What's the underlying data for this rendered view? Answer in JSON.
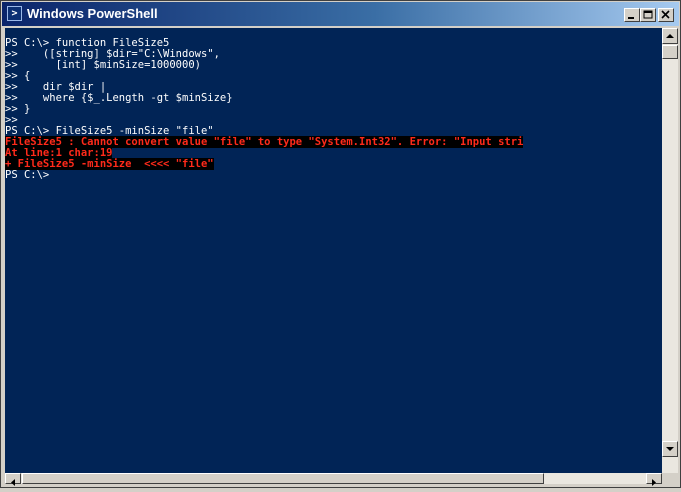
{
  "window": {
    "title": "Windows PowerShell",
    "icon": "powershell-icon",
    "accent_title_start": "#0a246a",
    "accent_title_end": "#a6caf0"
  },
  "console": {
    "background": "#012456",
    "foreground": "#ffffff",
    "error_color": "#ff2a1a",
    "lines": [
      {
        "text": "PS C:\\> function FileSize5",
        "kind": "normal"
      },
      {
        "text": ">>    ([string] $dir=\"C:\\Windows\",",
        "kind": "normal"
      },
      {
        "text": ">>      [int] $minSize=1000000)",
        "kind": "normal"
      },
      {
        "text": ">> {",
        "kind": "normal"
      },
      {
        "text": ">>    dir $dir |",
        "kind": "normal"
      },
      {
        "text": ">>    where {$_.Length -gt $minSize}",
        "kind": "normal"
      },
      {
        "text": ">> }",
        "kind": "normal"
      },
      {
        "text": ">>",
        "kind": "normal"
      },
      {
        "text": "PS C:\\> FileSize5 -minSize \"file\"",
        "kind": "normal"
      },
      {
        "text": "FileSize5 : Cannot convert value \"file\" to type \"System.Int32\". Error: \"Input stri",
        "kind": "error"
      },
      {
        "text": "At line:1 char:19",
        "kind": "error"
      },
      {
        "text": "+ FileSize5 -minSize  <<<< \"file\"",
        "kind": "error"
      },
      {
        "text": "PS C:\\>",
        "kind": "normal"
      }
    ]
  }
}
